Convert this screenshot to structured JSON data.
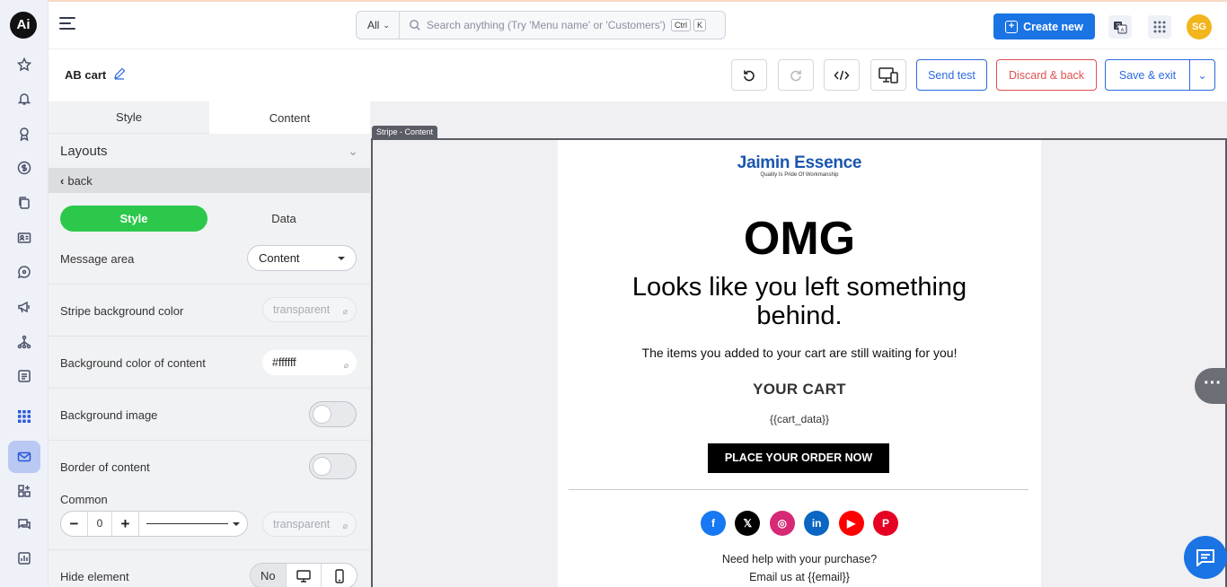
{
  "app": {
    "logo_text": "Ai"
  },
  "topbar": {
    "search_scope": "All",
    "search_placeholder": "Search anything (Try 'Menu name' or 'Customers')",
    "kbd_ctrl": "Ctrl",
    "kbd_k": "K",
    "create_label": "Create new",
    "avatar_initials": "SG"
  },
  "editor": {
    "title": "AB cart",
    "send_test": "Send test",
    "discard": "Discard & back",
    "save_exit": "Save & exit"
  },
  "panel": {
    "tabs": [
      "Style",
      "Content"
    ],
    "section": "Layouts",
    "back": "back",
    "segments": [
      "Style",
      "Data"
    ],
    "message_area": {
      "label": "Message area",
      "value": "Content"
    },
    "stripe_bg": {
      "label": "Stripe background color",
      "value": "transparent"
    },
    "content_bg": {
      "label": "Background color of content",
      "value": "#ffffff"
    },
    "bg_image": {
      "label": "Background image"
    },
    "border": {
      "label": "Border of content"
    },
    "common": {
      "label": "Common",
      "width": "0",
      "color": "transparent"
    },
    "hide": {
      "label": "Hide element",
      "no": "No"
    }
  },
  "canvas": {
    "stripe_tag": "Stripe - Content",
    "brand": "Jaimin Essence",
    "brand_tagline": "Quality Is Pride Of Workmanship",
    "headline": "OMG",
    "subheadline": "Looks like you left something behind.",
    "items_text": "The items you added to your cart are still waiting for you!",
    "cart_heading": "YOUR CART",
    "cart_placeholder": "{{cart_data}}",
    "cta": "PLACE YOUR ORDER NOW",
    "help_line1": "Need help with your purchase?",
    "help_line2": "Email us at {{email}}",
    "socials": [
      {
        "name": "facebook",
        "glyph": "f",
        "color": "#1877f2"
      },
      {
        "name": "x",
        "glyph": "𝕏",
        "color": "#000000"
      },
      {
        "name": "instagram",
        "glyph": "◎",
        "color": "#d62976"
      },
      {
        "name": "linkedin",
        "glyph": "in",
        "color": "#0a66c2"
      },
      {
        "name": "youtube",
        "glyph": "▶",
        "color": "#ff0000"
      },
      {
        "name": "pinterest",
        "glyph": "P",
        "color": "#e60023"
      }
    ]
  },
  "colors": {
    "accent": "#1b74e4",
    "success": "#2cc84b",
    "danger": "#e05050"
  }
}
